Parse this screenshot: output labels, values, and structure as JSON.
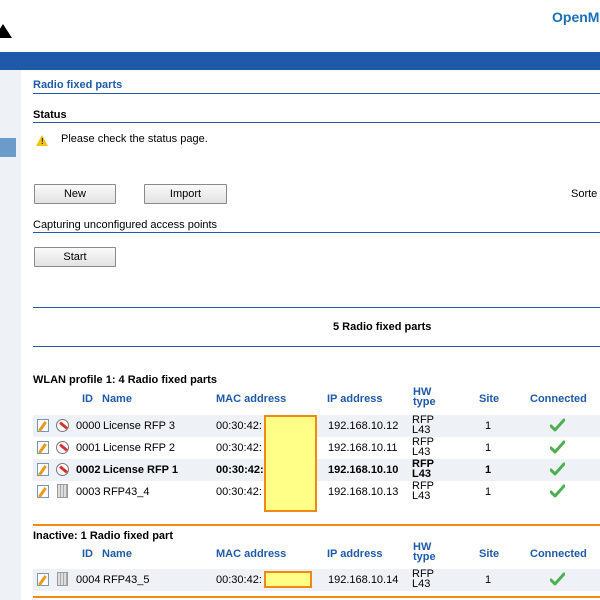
{
  "header": {
    "brand": "OpenM"
  },
  "page": {
    "title": "Radio fixed parts"
  },
  "status": {
    "title": "Status",
    "message": "Please check the status page."
  },
  "toolbar": {
    "new_label": "New",
    "import_label": "Import",
    "sorted_label": "Sorte"
  },
  "capture": {
    "title": "Capturing unconfigured access points",
    "start_label": "Start"
  },
  "summary": {
    "text": "5 Radio fixed parts"
  },
  "columns": {
    "id": "ID",
    "name": "Name",
    "mac": "MAC address",
    "ip": "IP address",
    "hw_line1": "HW",
    "hw_line2": "type",
    "site": "Site",
    "connected": "Connected"
  },
  "wlan_group": {
    "title": "WLAN profile 1: 4 Radio fixed parts",
    "rows": [
      {
        "id": "0000",
        "name": "License RFP 3",
        "mac": "00:30:42:",
        "ip": "192.168.10.12",
        "hw1": "RFP",
        "hw2": "L43",
        "site": "1",
        "connected": true,
        "icon": "unlock-icon",
        "bold": false
      },
      {
        "id": "0001",
        "name": "License RFP 2",
        "mac": "00:30:42:",
        "ip": "192.168.10.11",
        "hw1": "RFP",
        "hw2": "L43",
        "site": "1",
        "connected": true,
        "icon": "unlock-icon",
        "bold": false
      },
      {
        "id": "0002",
        "name": "License RFP 1",
        "mac": "00:30:42:",
        "ip": "192.168.10.10",
        "hw1": "RFP",
        "hw2": "L43",
        "site": "1",
        "connected": true,
        "icon": "unlock-icon",
        "bold": true
      },
      {
        "id": "0003",
        "name": "RFP43_4",
        "mac": "00:30:42:",
        "ip": "192.168.10.13",
        "hw1": "RFP",
        "hw2": "L43",
        "site": "1",
        "connected": true,
        "icon": "trash-icon",
        "bold": false
      }
    ]
  },
  "inactive_group": {
    "title": "Inactive: 1 Radio fixed part",
    "rows": [
      {
        "id": "0004",
        "name": "RFP43_5",
        "mac": "00:30:42:",
        "ip": "192.168.10.14",
        "hw1": "RFP",
        "hw2": "L43",
        "site": "1",
        "connected": true,
        "icon": "trash-icon",
        "bold": false
      }
    ]
  },
  "colors": {
    "accent": "#1f5aa8",
    "brand": "#1a6fb8",
    "highlight": "#ffff88",
    "highlight_border": "#f08a10",
    "check": "#4caf50"
  }
}
